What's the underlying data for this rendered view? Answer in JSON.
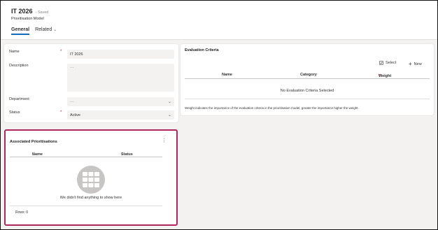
{
  "header": {
    "title": "IT 2026",
    "saved_status": "- Saved",
    "entity": "Prioritisation Model",
    "tabs": [
      {
        "label": "General",
        "active": true
      },
      {
        "label": "Related",
        "active": false
      }
    ]
  },
  "general": {
    "name_label": "Name",
    "name_value": "IT 2026",
    "description_label": "Description",
    "description_placeholder": "---",
    "department_label": "Department",
    "department_placeholder": "---",
    "status_label": "Status",
    "status_value": "Active",
    "required_marker": "*"
  },
  "evaluation": {
    "title": "Evaluation Criteria",
    "select_label": "Select",
    "new_label": "New",
    "columns": [
      "Name",
      "Category",
      "Weight"
    ],
    "empty_text": "No Evaluation Criteria Selected",
    "note": "Weight indicates the importance of the evaluation criteria in the prioritisation model, greater the importance higher the weight."
  },
  "associated": {
    "title": "Associated Prioritisations",
    "columns": [
      "Name",
      "Status"
    ],
    "sort_indicator": "↑",
    "empty_text": "We didn't find anything to show here",
    "rows_label": "Rows: 0"
  },
  "colors": {
    "accent": "#0f6cbd",
    "highlight_border": "#b0265f",
    "required": "#a4262c"
  }
}
